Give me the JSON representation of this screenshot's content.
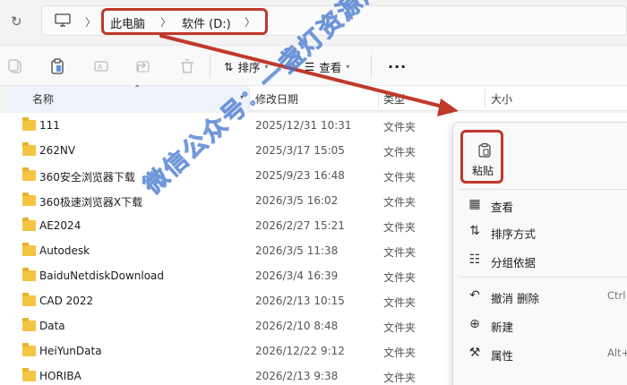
{
  "address_bar": {
    "crumbs": [
      "此电脑",
      "软件 (D:)"
    ]
  },
  "toolbar": {
    "sort_label": "排序",
    "view_label": "查看",
    "more_label": "···"
  },
  "columns": [
    "名称",
    "修改日期",
    "类型",
    "大小"
  ],
  "files": [
    {
      "name": "111",
      "date": "2025/12/31 10:31",
      "type": "文件夹"
    },
    {
      "name": "262NV",
      "date": "2025/3/17 15:05",
      "type": "文件夹"
    },
    {
      "name": "360安全浏览器下载",
      "date": "2025/9/23 16:48",
      "type": "文件夹"
    },
    {
      "name": "360极速浏览器X下载",
      "date": "2026/3/5 16:02",
      "type": "文件夹"
    },
    {
      "name": "AE2024",
      "date": "2026/2/27 15:21",
      "type": "文件夹"
    },
    {
      "name": "Autodesk",
      "date": "2026/3/5 11:38",
      "type": "文件夹"
    },
    {
      "name": "BaiduNetdiskDownload",
      "date": "2026/3/4 16:39",
      "type": "文件夹"
    },
    {
      "name": "CAD 2022",
      "date": "2026/2/13 10:15",
      "type": "文件夹"
    },
    {
      "name": "Data",
      "date": "2026/2/10 8:48",
      "type": "文件夹"
    },
    {
      "name": "HeiYunData",
      "date": "2026/12/22 9:12",
      "type": "文件夹"
    },
    {
      "name": "HORIBA",
      "date": "2026/2/13 9:38",
      "type": "文件夹"
    }
  ],
  "context_menu": {
    "paste_label": "粘贴",
    "items": [
      {
        "icon": "grid-icon",
        "label": "查看",
        "shortcut": ""
      },
      {
        "icon": "sort-icon",
        "label": "排序方式",
        "shortcut": ""
      },
      {
        "icon": "group-icon",
        "label": "分组依据",
        "shortcut": ""
      },
      {
        "icon": "undo-icon",
        "label": "撤消 删除",
        "shortcut": "Ctrl+"
      },
      {
        "icon": "new-icon",
        "label": "新建",
        "shortcut": ""
      },
      {
        "icon": "wrench-icon",
        "label": "属性",
        "shortcut": "Alt+"
      }
    ]
  },
  "watermark": "微信公众号：一盏灯资源库",
  "colors": {
    "highlight_red": "#c0392b",
    "folder_yellow": "#f4c542",
    "watermark_blue": "#5a96e6"
  }
}
